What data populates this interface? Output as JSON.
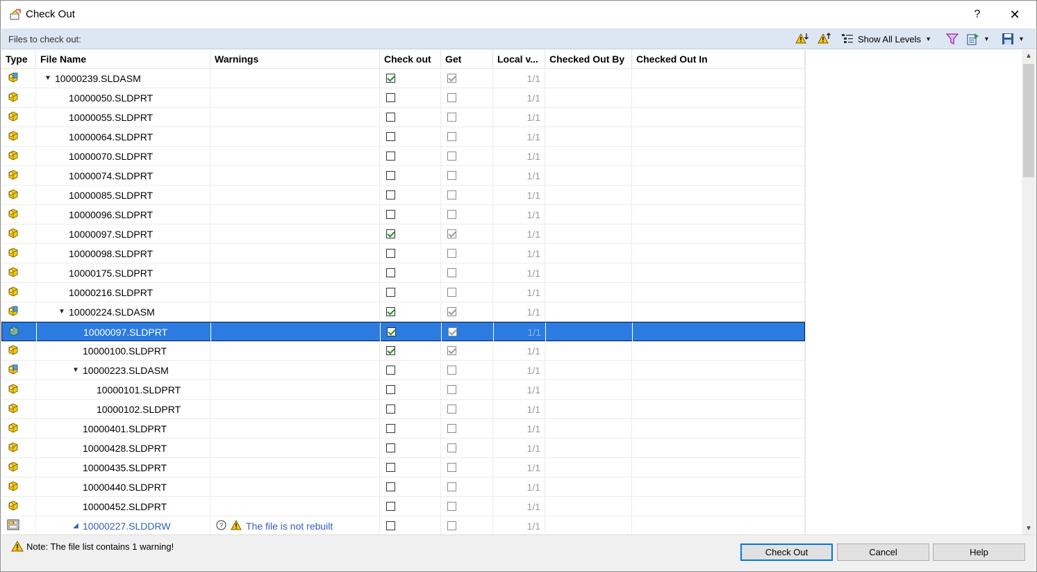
{
  "window": {
    "title": "Check Out",
    "help_label": "?",
    "close_label": "✕"
  },
  "toolbar": {
    "files_label": "Files to check out:",
    "show_levels_label": "Show All Levels"
  },
  "columns": [
    "Type",
    "File Name",
    "Warnings",
    "Check out",
    "Get",
    "Local v...",
    "Checked Out By",
    "Checked Out In"
  ],
  "rows": [
    {
      "type": "assembly",
      "indent": 0,
      "expander": true,
      "name": "10000239.SLDASM",
      "warning": "",
      "check_out": true,
      "get": true,
      "local_version": "1/1",
      "checked_out_by": "",
      "checked_out_in": ""
    },
    {
      "type": "part",
      "indent": 1,
      "expander": false,
      "name": "10000050.SLDPRT",
      "warning": "",
      "check_out": false,
      "get": false,
      "local_version": "1/1",
      "checked_out_by": "",
      "checked_out_in": ""
    },
    {
      "type": "part",
      "indent": 1,
      "expander": false,
      "name": "10000055.SLDPRT",
      "warning": "",
      "check_out": false,
      "get": false,
      "local_version": "1/1",
      "checked_out_by": "",
      "checked_out_in": ""
    },
    {
      "type": "part",
      "indent": 1,
      "expander": false,
      "name": "10000064.SLDPRT",
      "warning": "",
      "check_out": false,
      "get": false,
      "local_version": "1/1",
      "checked_out_by": "",
      "checked_out_in": ""
    },
    {
      "type": "part",
      "indent": 1,
      "expander": false,
      "name": "10000070.SLDPRT",
      "warning": "",
      "check_out": false,
      "get": false,
      "local_version": "1/1",
      "checked_out_by": "",
      "checked_out_in": ""
    },
    {
      "type": "part",
      "indent": 1,
      "expander": false,
      "name": "10000074.SLDPRT",
      "warning": "",
      "check_out": false,
      "get": false,
      "local_version": "1/1",
      "checked_out_by": "",
      "checked_out_in": ""
    },
    {
      "type": "part",
      "indent": 1,
      "expander": false,
      "name": "10000085.SLDPRT",
      "warning": "",
      "check_out": false,
      "get": false,
      "local_version": "1/1",
      "checked_out_by": "",
      "checked_out_in": ""
    },
    {
      "type": "part",
      "indent": 1,
      "expander": false,
      "name": "10000096.SLDPRT",
      "warning": "",
      "check_out": false,
      "get": false,
      "local_version": "1/1",
      "checked_out_by": "",
      "checked_out_in": ""
    },
    {
      "type": "part",
      "indent": 1,
      "expander": false,
      "name": "10000097.SLDPRT",
      "warning": "",
      "check_out": true,
      "get": true,
      "local_version": "1/1",
      "checked_out_by": "",
      "checked_out_in": ""
    },
    {
      "type": "part",
      "indent": 1,
      "expander": false,
      "name": "10000098.SLDPRT",
      "warning": "",
      "check_out": false,
      "get": false,
      "local_version": "1/1",
      "checked_out_by": "",
      "checked_out_in": ""
    },
    {
      "type": "part",
      "indent": 1,
      "expander": false,
      "name": "10000175.SLDPRT",
      "warning": "",
      "check_out": false,
      "get": false,
      "local_version": "1/1",
      "checked_out_by": "",
      "checked_out_in": ""
    },
    {
      "type": "part",
      "indent": 1,
      "expander": false,
      "name": "10000216.SLDPRT",
      "warning": "",
      "check_out": false,
      "get": false,
      "local_version": "1/1",
      "checked_out_by": "",
      "checked_out_in": ""
    },
    {
      "type": "assembly",
      "indent": 1,
      "expander": true,
      "name": "10000224.SLDASM",
      "warning": "",
      "check_out": true,
      "get": true,
      "local_version": "1/1",
      "checked_out_by": "",
      "checked_out_in": ""
    },
    {
      "type": "part",
      "indent": 2,
      "expander": false,
      "name": "10000097.SLDPRT",
      "warning": "",
      "check_out": true,
      "get": true,
      "local_version": "1/1",
      "checked_out_by": "",
      "checked_out_in": "",
      "selected": true
    },
    {
      "type": "part",
      "indent": 2,
      "expander": false,
      "name": "10000100.SLDPRT",
      "warning": "",
      "check_out": true,
      "get": true,
      "local_version": "1/1",
      "checked_out_by": "",
      "checked_out_in": ""
    },
    {
      "type": "assembly",
      "indent": 2,
      "expander": true,
      "name": "10000223.SLDASM",
      "warning": "",
      "check_out": false,
      "get": false,
      "local_version": "1/1",
      "checked_out_by": "",
      "checked_out_in": ""
    },
    {
      "type": "part",
      "indent": 3,
      "expander": false,
      "name": "10000101.SLDPRT",
      "warning": "",
      "check_out": false,
      "get": false,
      "local_version": "1/1",
      "checked_out_by": "",
      "checked_out_in": ""
    },
    {
      "type": "part",
      "indent": 3,
      "expander": false,
      "name": "10000102.SLDPRT",
      "warning": "",
      "check_out": false,
      "get": false,
      "local_version": "1/1",
      "checked_out_by": "",
      "checked_out_in": ""
    },
    {
      "type": "part",
      "indent": 2,
      "expander": false,
      "name": "10000401.SLDPRT",
      "warning": "",
      "check_out": false,
      "get": false,
      "local_version": "1/1",
      "checked_out_by": "",
      "checked_out_in": ""
    },
    {
      "type": "part",
      "indent": 2,
      "expander": false,
      "name": "10000428.SLDPRT",
      "warning": "",
      "check_out": false,
      "get": false,
      "local_version": "1/1",
      "checked_out_by": "",
      "checked_out_in": ""
    },
    {
      "type": "part",
      "indent": 2,
      "expander": false,
      "name": "10000435.SLDPRT",
      "warning": "",
      "check_out": false,
      "get": false,
      "local_version": "1/1",
      "checked_out_by": "",
      "checked_out_in": ""
    },
    {
      "type": "part",
      "indent": 2,
      "expander": false,
      "name": "10000440.SLDPRT",
      "warning": "",
      "check_out": false,
      "get": false,
      "local_version": "1/1",
      "checked_out_by": "",
      "checked_out_in": ""
    },
    {
      "type": "part",
      "indent": 2,
      "expander": false,
      "name": "10000452.SLDPRT",
      "warning": "",
      "check_out": false,
      "get": false,
      "local_version": "1/1",
      "checked_out_by": "",
      "checked_out_in": ""
    },
    {
      "type": "drawing",
      "indent": 2,
      "expander": true,
      "name": "10000227.SLDDRW",
      "warning": "The file is not rebuilt",
      "check_out": false,
      "get": false,
      "local_version": "1/1",
      "checked_out_by": "",
      "checked_out_in": "",
      "link": true
    }
  ],
  "footer": {
    "note": "Note: The file list contains 1 warning!",
    "check_out_label": "Check Out",
    "cancel_label": "Cancel",
    "help_label": "Help"
  },
  "colors": {
    "toolbar_bg": "#dde6f3",
    "selection": "#2c7be0",
    "link": "#2f5fbf",
    "check": "#1f8f1f",
    "part_icon": "#e8c21a",
    "assembly_icon": "#4aa0e0"
  },
  "icons": {
    "title": "checkout-icon",
    "part": "part-icon",
    "assembly": "assembly-icon",
    "drawing": "drawing-icon",
    "warning": "warning-icon",
    "question": "question-icon"
  }
}
